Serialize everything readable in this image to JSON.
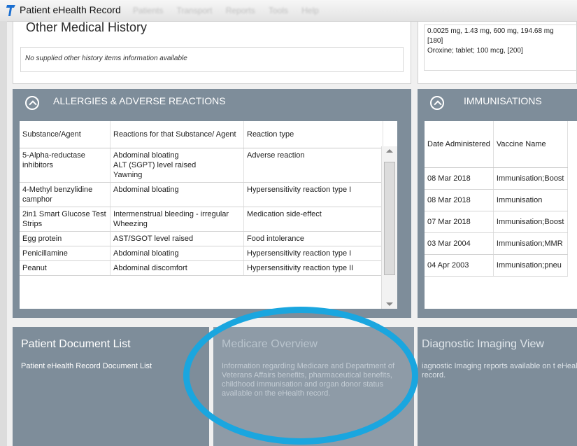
{
  "window": {
    "title": "Patient eHealth Record",
    "menu": [
      "Patients",
      "Transport",
      "Reports",
      "Tools",
      "Help"
    ],
    "accent_color": "#1aa6df",
    "panel_color": "#7e8d9a"
  },
  "other_medical_history": {
    "title": "Other Medical History",
    "empty_message": "No supplied other history items information available"
  },
  "medications": {
    "line1": "0.0025 mg, 1.43 mg, 600 mg, 194.68 mg",
    "line2": "[180]",
    "line3": "Oroxine; tablet; 100 mcg, [200]"
  },
  "allergies": {
    "title": "ALLERGIES & ADVERSE REACTIONS",
    "headers": [
      "Substance/Agent",
      "Reactions for that Substance/ Agent",
      "Reaction type"
    ],
    "rows": [
      {
        "substance": "5-Alpha-reductase inhibitors",
        "reactions": [
          "Abdominal bloating",
          "ALT (SGPT) level raised",
          "Yawning"
        ],
        "type": "Adverse reaction"
      },
      {
        "substance": "4-Methyl benzylidine camphor",
        "reactions": [
          "Abdominal bloating"
        ],
        "type": "Hypersensitivity reaction type I"
      },
      {
        "substance": "2in1 Smart Glucose Test Strips",
        "reactions": [
          "Intermenstrual bleeding - irregular",
          "Wheezing"
        ],
        "type": "Medication side-effect"
      },
      {
        "substance": "Egg protein",
        "reactions": [
          "AST/SGOT level raised"
        ],
        "type": "Food intolerance"
      },
      {
        "substance": "Penicillamine",
        "reactions": [
          "Abdominal bloating"
        ],
        "type": "Hypersensitivity reaction type I"
      },
      {
        "substance": "Peanut",
        "reactions": [
          "Abdominal discomfort"
        ],
        "type": "Hypersensitivity reaction type II"
      }
    ]
  },
  "immunisations": {
    "title": "IMMUNISATIONS",
    "headers": [
      "Date Administered",
      "Vaccine Name"
    ],
    "rows": [
      {
        "date": "08 Mar 2018",
        "vaccine": "Immunisation;Boost"
      },
      {
        "date": "08 Mar 2018",
        "vaccine": "Immunisation"
      },
      {
        "date": "07 Mar 2018",
        "vaccine": "Immunisation;Boost"
      },
      {
        "date": "03 Mar 2004",
        "vaccine": "Immunisation;MMR"
      },
      {
        "date": "04 Apr 2003",
        "vaccine": "Immunisation;pneu"
      }
    ]
  },
  "tiles": {
    "document_list": {
      "title": "Patient Document List",
      "text": "Patient eHealth Record Document List"
    },
    "medicare": {
      "title": "Medicare Overview",
      "text": "Information regarding Medicare and Department of Veterans Affairs benefits, pharmaceutical benefits, childhood immunisation and organ donor status available on the eHealth record."
    },
    "diagnostic": {
      "title": "Diagnostic Imaging View",
      "text": "iagnostic Imaging reports available on t eHealth record."
    }
  }
}
